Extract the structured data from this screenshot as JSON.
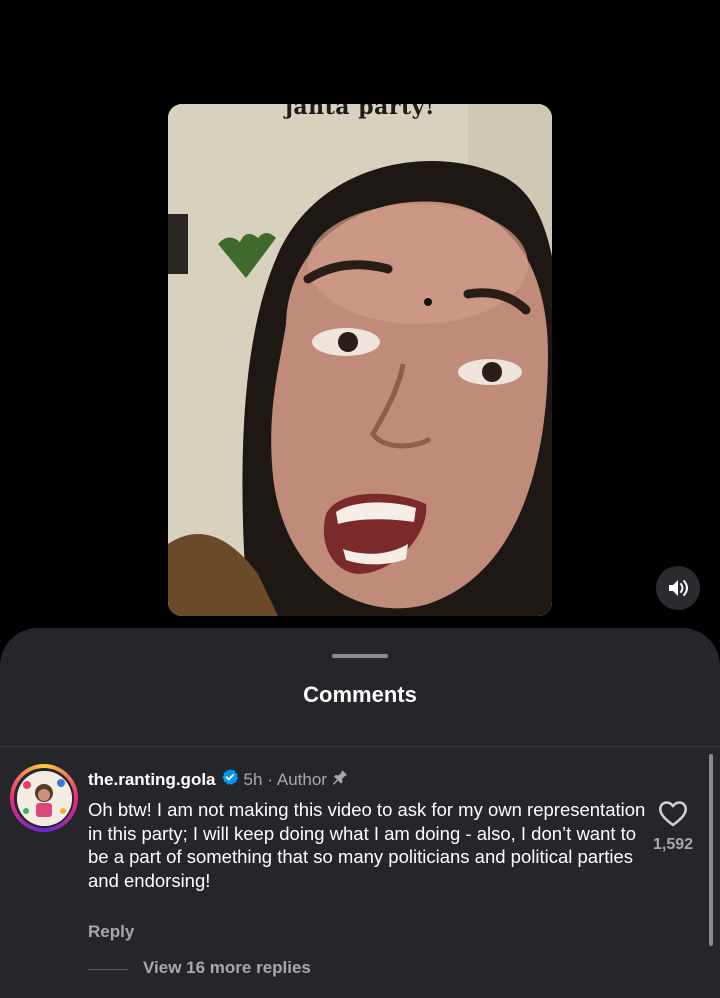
{
  "video": {
    "caption_partial": "janta party!"
  },
  "comments_sheet": {
    "title": "Comments",
    "comment": {
      "username": "the.ranting.gola",
      "verified": true,
      "time": "5h",
      "author_badge": "· Author",
      "pinned": true,
      "text": "Oh btw! I am not making this video to ask for my own representation in this party; I will keep doing what I am doing - also, I don’t want to be a part of something that so many politicians and political parties and endorsing!",
      "like_count": "1,592",
      "reply_label": "Reply",
      "view_replies_label": "View 16 more replies"
    }
  },
  "icons": {
    "sound": "speaker-icon",
    "verified": "verified-badge-icon",
    "pin": "pin-icon",
    "like": "heart-icon"
  },
  "colors": {
    "sheet_bg": "#25262a",
    "verified_blue": "#0095f6",
    "muted_text": "#a8a8ab"
  }
}
